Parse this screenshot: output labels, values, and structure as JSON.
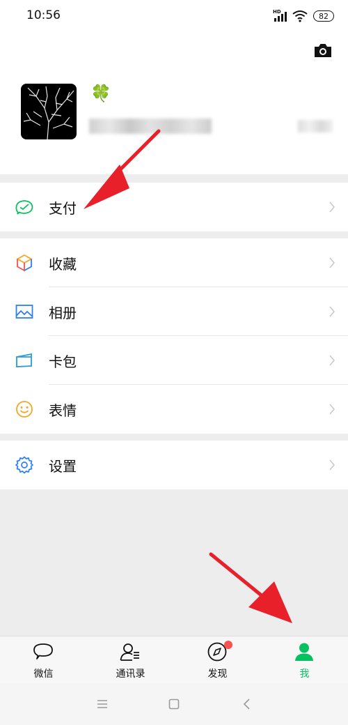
{
  "status_bar": {
    "time": "10:56",
    "network": "HD",
    "battery": "82"
  },
  "profile": {
    "nickname": "🍀"
  },
  "menu": {
    "pay": "支付",
    "favorites": "收藏",
    "album": "相册",
    "cards": "卡包",
    "stickers": "表情",
    "settings": "设置"
  },
  "tabs": [
    {
      "label": "微信",
      "icon": "chat-bubble-icon"
    },
    {
      "label": "通讯录",
      "icon": "contacts-icon"
    },
    {
      "label": "发现",
      "icon": "compass-icon",
      "badge": true
    },
    {
      "label": "我",
      "icon": "person-icon",
      "active": true
    }
  ],
  "colors": {
    "accent": "#07c160",
    "badge": "#fa5151",
    "arrow": "#e8202a"
  }
}
